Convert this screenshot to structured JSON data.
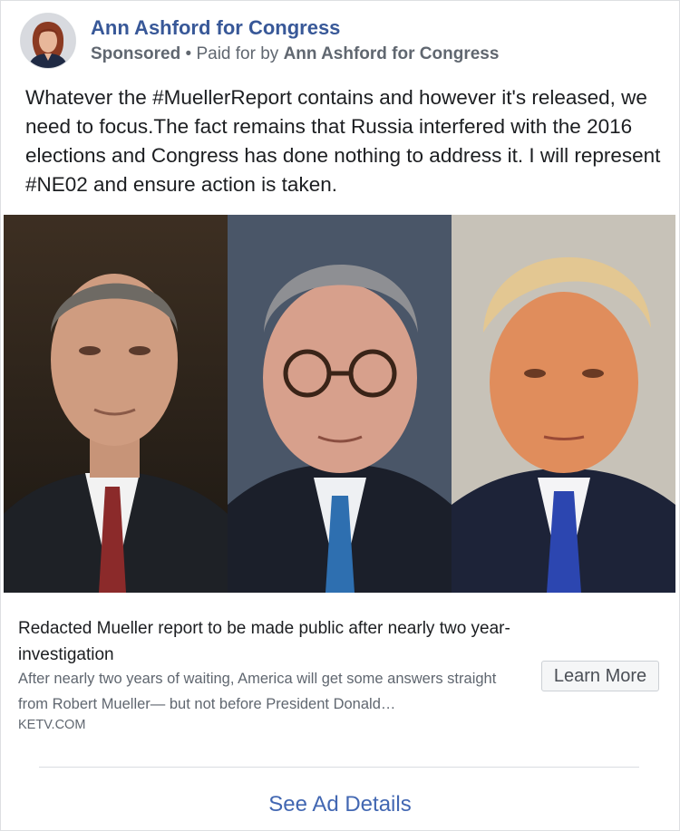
{
  "post": {
    "page_name": "Ann Ashford for Congress",
    "sponsored_label": "Sponsored",
    "separator": " • ",
    "paid_for_prefix": "Paid for by ",
    "paid_for_name": "Ann Ashford for Congress",
    "text": "Whatever the #MuellerReport contains and however it's released, we need to focus.The fact remains that Russia interfered with the 2016 elections and Congress has done nothing to address it. I will represent #NE02 and ensure action is taken."
  },
  "link_preview": {
    "title": "Redacted Mueller report to be made public after nearly two year-investigation",
    "description": "After nearly two years of waiting, America will get some answers straight from Robert Mueller— but not before President Donald…",
    "domain": "KETV.COM",
    "cta_label": "Learn More"
  },
  "footer": {
    "see_ad_details": "See Ad Details"
  },
  "colors": {
    "link_blue": "#385898",
    "secondary_text": "#606770",
    "primary_text": "#1c1e21",
    "action_blue": "#4267b2"
  }
}
